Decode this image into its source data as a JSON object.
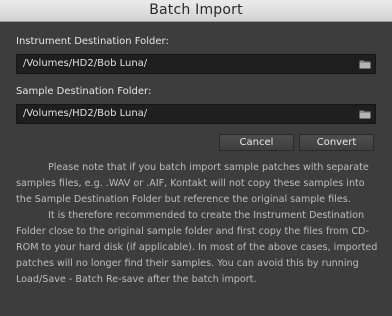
{
  "window": {
    "title": "Batch Import"
  },
  "instrument": {
    "label": "Instrument Destination Folder:",
    "path": "/Volumes/HD2/Bob Luna/"
  },
  "sample": {
    "label": "Sample Destination Folder:",
    "path": "/Volumes/HD2/Bob Luna/"
  },
  "buttons": {
    "cancel": "Cancel",
    "convert": "Convert"
  },
  "note": {
    "paragraph1": "Please note that if you batch import sample patches with separate samples files, e.g. .WAV or .AIF, Kontakt will not copy these samples into the Sample Destination Folder but reference the original sample files.",
    "paragraph2": "It is therefore recommended to create the Instrument Destination Folder close to the original sample folder and first copy the files from CD-ROM to your hard disk (if applicable). In most of the above cases, imported patches will no longer find their samples. You can avoid this by running Load/Save - Batch Re-save after the batch import."
  },
  "icons": {
    "folder": "folder-icon"
  },
  "colors": {
    "background": "#3d3d3d",
    "field": "#1f1f1f",
    "text": "#e6e6e6",
    "note_text": "#bdbdbd"
  }
}
